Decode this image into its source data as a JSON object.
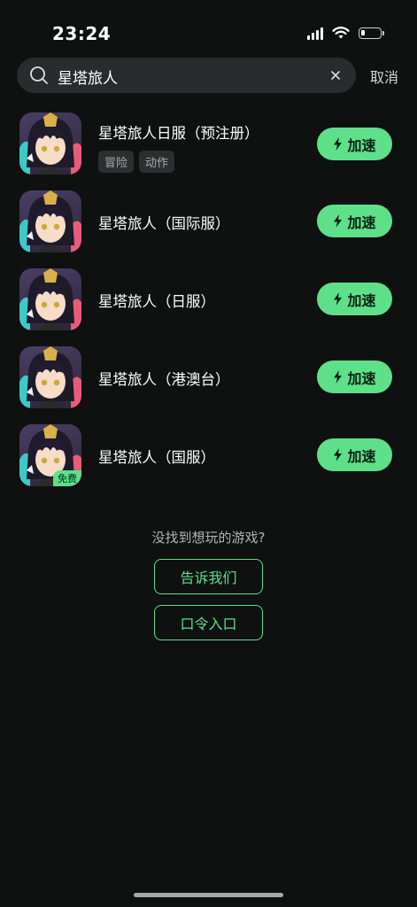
{
  "status": {
    "time": "23:24"
  },
  "search": {
    "query": "星塔旅人",
    "cancel_label": "取消"
  },
  "games": [
    {
      "title": "星塔旅人日服（预注册）",
      "tags": [
        "冒险",
        "动作"
      ],
      "button": "加速"
    },
    {
      "title": "星塔旅人（国际服）",
      "button": "加速"
    },
    {
      "title": "星塔旅人（日服）",
      "button": "加速"
    },
    {
      "title": "星塔旅人（港澳台）",
      "button": "加速"
    },
    {
      "title": "星塔旅人（国服）",
      "button": "加速",
      "badge": "免费"
    }
  ],
  "footer": {
    "not_found_text": "没找到想玩的游戏?",
    "tell_us_label": "告诉我们",
    "code_entry_label": "口令入口"
  },
  "colors": {
    "accent": "#5ee08a",
    "background": "#0f1010",
    "search_bg": "#2a2b2c"
  }
}
